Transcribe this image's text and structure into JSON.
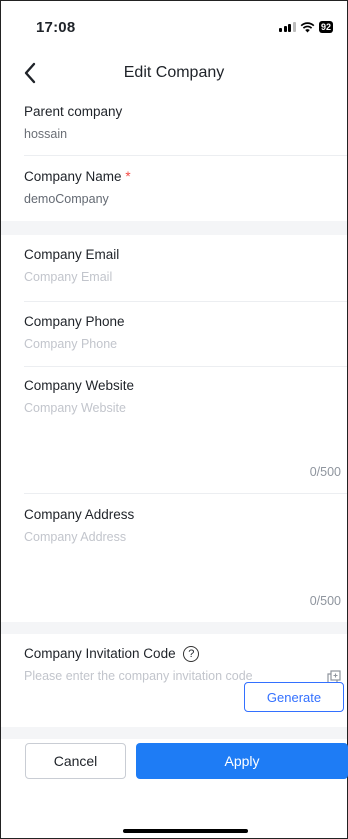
{
  "status_bar": {
    "time": "17:08",
    "battery": "92"
  },
  "nav": {
    "title": "Edit Company"
  },
  "parent_company": {
    "label": "Parent company",
    "value": "hossain"
  },
  "company_name": {
    "label": "Company Name",
    "required_mark": "*",
    "value": "demoCompany"
  },
  "company_email": {
    "label": "Company Email",
    "placeholder": "Company Email"
  },
  "company_phone": {
    "label": "Company Phone",
    "placeholder": "Company Phone"
  },
  "company_website": {
    "label": "Company Website",
    "placeholder": "Company Website",
    "counter": "0/500"
  },
  "company_address": {
    "label": "Company Address",
    "placeholder": "Company Address",
    "counter": "0/500"
  },
  "invitation_code": {
    "label": "Company Invitation Code",
    "help": "?",
    "placeholder": "Please enter the company invitation code"
  },
  "actions": {
    "generate": "Generate",
    "cancel": "Cancel",
    "apply": "Apply"
  },
  "colors": {
    "accent": "#1e7cf5",
    "link": "#3370ff",
    "required": "#f54a45"
  },
  "icons": [
    "back-icon",
    "signal-icon",
    "wifi-icon",
    "battery-icon",
    "help-icon",
    "copy-icon"
  ]
}
